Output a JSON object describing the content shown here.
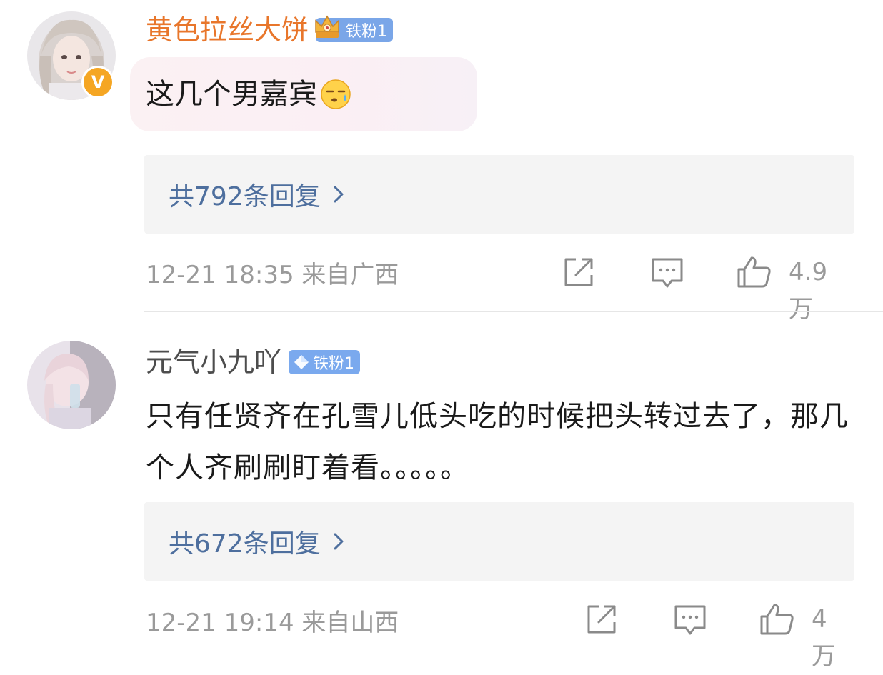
{
  "comments": [
    {
      "username": "黄色拉丝大饼",
      "badge_label": "铁粉1",
      "text": "这几个男嘉宾",
      "replies_label": "共792条回复",
      "time": "12-21 18:35",
      "location": "来自广西",
      "likes": "4.9万",
      "verified": "V",
      "icons": [
        "crown-badge-icon",
        "sweat-emoji-icon",
        "share-icon",
        "comment-icon",
        "like-icon",
        "chevron-right-icon"
      ]
    },
    {
      "username": "元气小九吖",
      "badge_label": "铁粉1",
      "text": "只有任贤齐在孔雪儿低头吃的时候把头转过去了，那几个人齐刷刷盯着看。。。。。",
      "replies_label": "共672条回复",
      "time": "12-21 19:14",
      "location": "来自山西",
      "likes": "4万",
      "icons": [
        "diamond-badge-icon",
        "share-icon",
        "comment-icon",
        "like-icon",
        "chevron-right-icon"
      ]
    }
  ],
  "colors": {
    "username_highlight": "#e8762b",
    "username_normal": "#4d4d4d",
    "link_blue": "#4e6f9e",
    "meta_gray": "#9a9a9a",
    "reply_bg": "#f4f4f4",
    "badge_blue": "#7aa6e8",
    "verified_orange": "#f5a623"
  }
}
